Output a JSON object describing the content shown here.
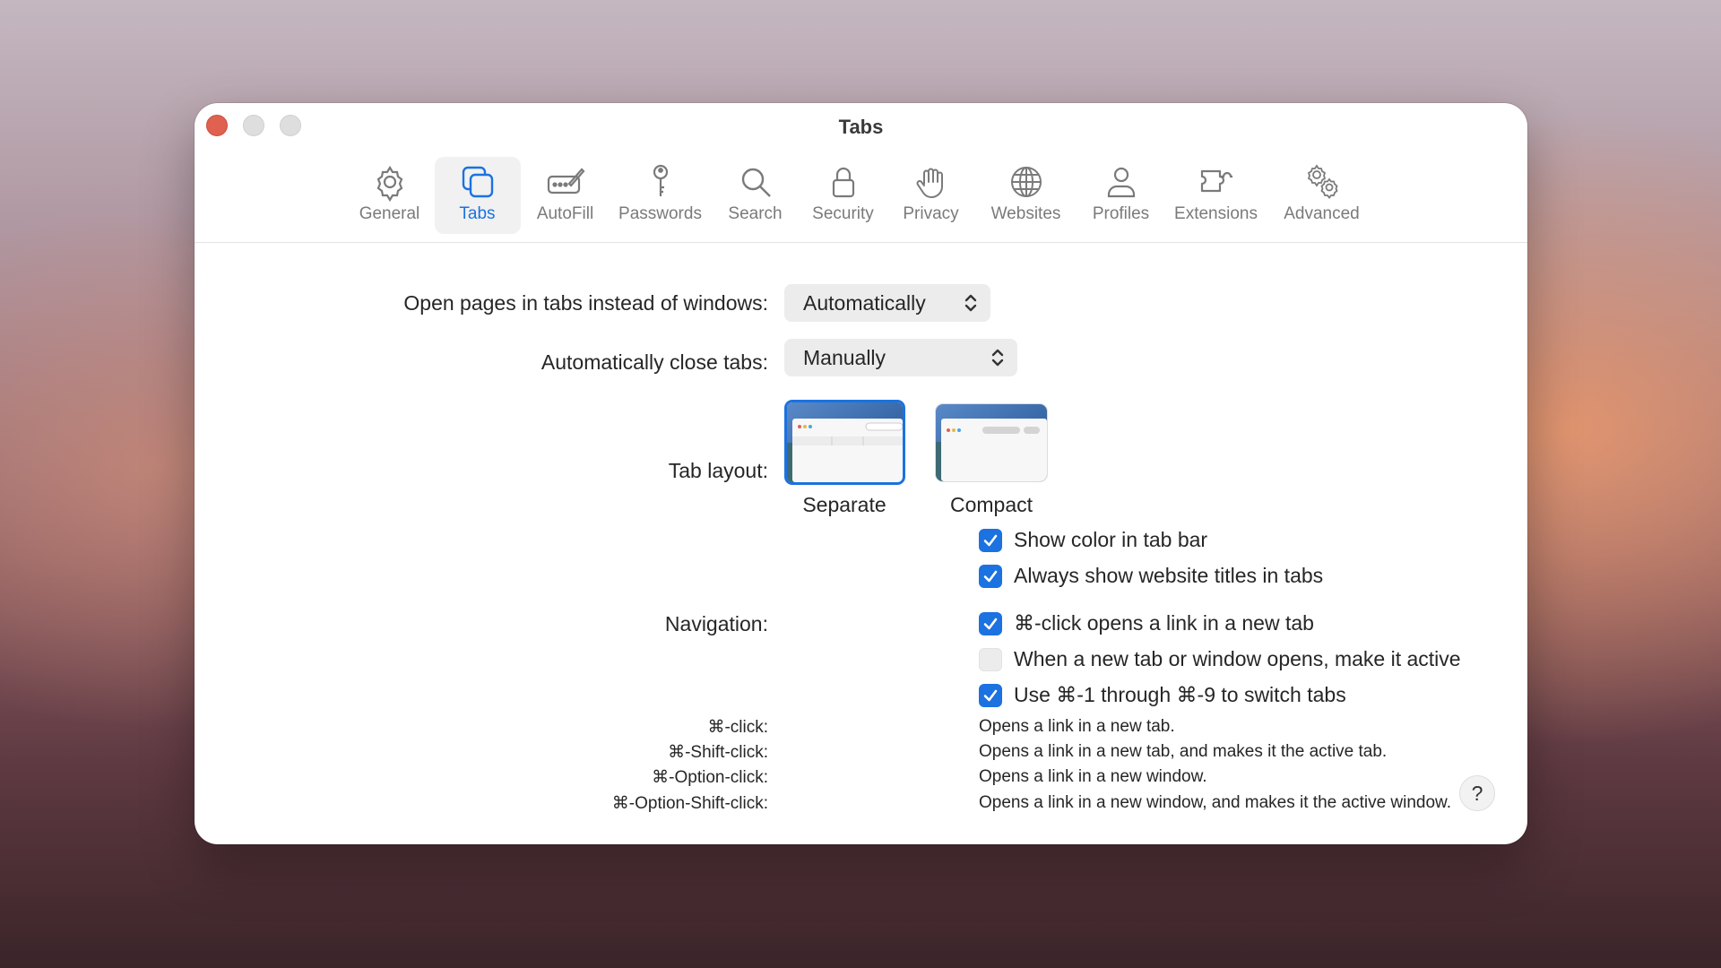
{
  "window": {
    "title": "Tabs"
  },
  "toolbar": {
    "items": [
      {
        "label": "General",
        "icon": "gear-icon",
        "active": false
      },
      {
        "label": "Tabs",
        "icon": "tabs-icon",
        "active": true
      },
      {
        "label": "AutoFill",
        "icon": "autofill-icon",
        "active": false
      },
      {
        "label": "Passwords",
        "icon": "key-icon",
        "active": false
      },
      {
        "label": "Search",
        "icon": "search-icon",
        "active": false
      },
      {
        "label": "Security",
        "icon": "lock-icon",
        "active": false
      },
      {
        "label": "Privacy",
        "icon": "hand-icon",
        "active": false
      },
      {
        "label": "Websites",
        "icon": "globe-icon",
        "active": false
      },
      {
        "label": "Profiles",
        "icon": "person-icon",
        "active": false
      },
      {
        "label": "Extensions",
        "icon": "puzzle-icon",
        "active": false
      },
      {
        "label": "Advanced",
        "icon": "gears-icon",
        "active": false
      }
    ]
  },
  "settings": {
    "open_pages": {
      "label": "Open pages in tabs instead of windows:",
      "value": "Automatically"
    },
    "close_tabs": {
      "label": "Automatically close tabs:",
      "value": "Manually"
    },
    "tab_layout": {
      "label": "Tab layout:",
      "options": [
        {
          "label": "Separate",
          "selected": true
        },
        {
          "label": "Compact",
          "selected": false
        }
      ]
    },
    "layout_checks": [
      {
        "label": "Show color in tab bar",
        "checked": true
      },
      {
        "label": "Always show website titles in tabs",
        "checked": true
      }
    ],
    "navigation": {
      "label": "Navigation:",
      "checks": [
        {
          "label": "⌘-click opens a link in a new tab",
          "checked": true
        },
        {
          "label": "When a new tab or window opens, make it active",
          "checked": false
        },
        {
          "label": "Use ⌘-1 through ⌘-9 to switch tabs",
          "checked": true
        }
      ]
    },
    "shortcuts": [
      {
        "key": "⌘-click:",
        "desc": "Opens a link in a new tab."
      },
      {
        "key": "⌘-Shift-click:",
        "desc": "Opens a link in a new tab, and makes it the active tab."
      },
      {
        "key": "⌘-Option-click:",
        "desc": "Opens a link in a new window."
      },
      {
        "key": "⌘-Option-Shift-click:",
        "desc": "Opens a link in a new window, and makes it the active window."
      }
    ]
  },
  "help": {
    "label": "?"
  },
  "colors": {
    "accent": "#1b72e0",
    "close": "#e0614f"
  }
}
